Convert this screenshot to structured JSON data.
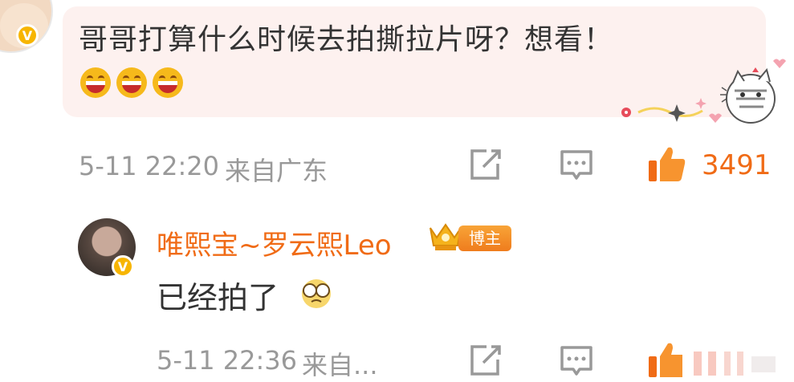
{
  "comment": {
    "text": "哥哥打算什么时候去拍撕拉片呀？想看！",
    "emojis": [
      "grin-emoji",
      "grin-emoji",
      "grin-emoji"
    ],
    "time": "5-11 22:20",
    "source": "来自广东",
    "like_count": "3491",
    "avatar_badge": "V",
    "bubble_color": "#fdf1ef"
  },
  "reply": {
    "author": "唯熙宝~罗云熙Leo",
    "badge_label": "博主",
    "avatar_badge": "V",
    "text": "已经拍了",
    "time": "5-11 22:36",
    "source": "来自..."
  },
  "colors": {
    "accent": "#f06b16",
    "meta_text": "#999999",
    "verified": "#f7b500"
  }
}
